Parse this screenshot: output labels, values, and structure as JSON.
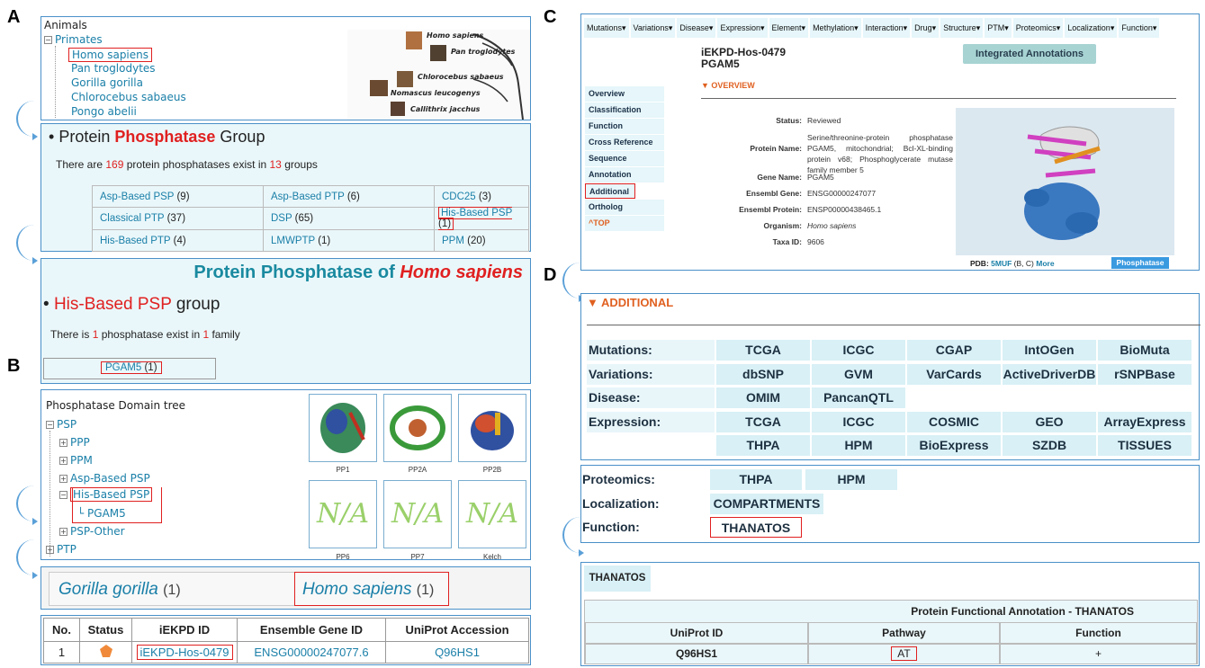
{
  "labels": {
    "a": "A",
    "b": "B",
    "c": "C",
    "d": "D"
  },
  "animals": {
    "title": "Animals",
    "root": "Primates",
    "items": [
      "Homo sapiens",
      "Pan troglodytes",
      "Gorilla gorilla",
      "Chlorocebus sabaeus",
      "Pongo abelii"
    ],
    "tree_species": [
      "Homo sapiens",
      "Pan troglodytes",
      "Chlorocebus sabaeus",
      "Nomascus leucogenys",
      "Callithrix jacchus"
    ]
  },
  "group": {
    "bullet": "•",
    "title_pre": "Protein ",
    "title_red": "Phosphatase",
    "title_post": " Group",
    "sub_pre": "There are ",
    "count": "169",
    "sub_mid": " protein phosphatases exist in ",
    "groups": "13",
    "sub_post": " groups",
    "cells": [
      {
        "name": "Asp-Based PSP",
        "count": "(9)"
      },
      {
        "name": "Asp-Based PTP",
        "count": "(6)"
      },
      {
        "name": "CDC25",
        "count": "(3)"
      },
      {
        "name": "Classical PTP",
        "count": "(37)"
      },
      {
        "name": "DSP",
        "count": "(65)"
      },
      {
        "name": "His-Based PSP",
        "count": "(1)"
      },
      {
        "name": "His-Based PTP",
        "count": "(4)"
      },
      {
        "name": "LMWPTP",
        "count": "(1)"
      },
      {
        "name": "PPM",
        "count": "(20)"
      }
    ]
  },
  "species_page": {
    "title_pre": "Protein Phosphatase of ",
    "title_species": "Homo sapiens",
    "bullet": "•",
    "group_red": "His-Based PSP",
    "group_post": " group",
    "sub_pre": "There is ",
    "n1": "1",
    "sub_mid": " phosphatase exist in ",
    "n2": "1",
    "sub_post": " family",
    "family": "PGAM5",
    "family_count": "(1)"
  },
  "domain_tree": {
    "title": "Phosphatase Domain tree",
    "root": "PSP",
    "items": [
      "PPP",
      "PPM",
      "Asp-Based PSP",
      "His-Based PSP",
      "PGAM5",
      "PSP-Other",
      "PTP"
    ],
    "thumbs": [
      "PP1",
      "PP2A",
      "PP2B",
      "PP6",
      "PP7",
      "Kelch"
    ],
    "na": "N/A"
  },
  "species_tabs": [
    {
      "name": "Gorilla gorilla",
      "count": "(1)"
    },
    {
      "name": "Homo sapiens",
      "count": "(1)"
    }
  ],
  "results_table": {
    "headers": [
      "No.",
      "Status",
      "iEKPD ID",
      "Ensemble Gene ID",
      "UniProt Accession"
    ],
    "row": {
      "no": "1",
      "id": "iEKPD-Hos-0479",
      "gene": "ENSG00000247077.6",
      "uniprot": "Q96HS1"
    },
    "status_color": "#f08a3a"
  },
  "detail": {
    "menu": [
      "Mutations▾",
      "Variations▾",
      "Disease▾",
      "Expression▾",
      "Element▾",
      "Methylation▾",
      "Interaction▾",
      "Drug▾",
      "Structure▾",
      "PTM▾",
      "Proteomics▾",
      "Localization▾",
      "Function▾"
    ],
    "id": "iEKPD-Hos-0479",
    "gene": "PGAM5",
    "integrated": "Integrated Annotations",
    "overview_hdr": "▼ OVERVIEW",
    "side": [
      "Overview",
      "Classification",
      "Function",
      "Cross Reference",
      "Sequence",
      "Annotation",
      "Additional",
      "Ortholog",
      "^TOP"
    ],
    "fields": [
      {
        "label": "Status:",
        "value": "Reviewed"
      },
      {
        "label": "Protein Name:",
        "value": "Serine/threonine-protein phosphatase PGAM5, mitochondrial;  Bcl-XL-binding  protein  v68; Phosphoglycerate mutase family member 5"
      },
      {
        "label": "Gene Name:",
        "value": "PGAM5"
      },
      {
        "label": "Ensembl Gene:",
        "value": "ENSG00000247077"
      },
      {
        "label": "Ensembl Protein:",
        "value": "ENSP00000438465.1"
      },
      {
        "label": "Organism:",
        "value": "Homo sapiens"
      },
      {
        "label": "Taxa ID:",
        "value": "9606"
      }
    ],
    "pdb_label": "PDB:",
    "pdb_id": "5MUF",
    "pdb_chains": "(B, C)",
    "pdb_more": "More",
    "badge": "Phosphatase"
  },
  "additional": {
    "header": "▼ ADDITIONAL",
    "rows": [
      {
        "label": "Mutations:",
        "items": [
          "TCGA",
          "ICGC",
          "CGAP",
          "IntOGen",
          "BioMuta"
        ]
      },
      {
        "label": "Variations:",
        "items": [
          "dbSNP",
          "GVM",
          "VarCards",
          "ActiveDriverDB",
          "rSNPBase"
        ]
      },
      {
        "label": "Disease:",
        "items": [
          "OMIM",
          "PancanQTL"
        ]
      },
      {
        "label": "Expression:",
        "items": [
          "TCGA",
          "ICGC",
          "COSMIC",
          "GEO",
          "ArrayExpress"
        ]
      },
      {
        "label": "",
        "items": [
          "THPA",
          "HPM",
          "BioExpress",
          "SZDB",
          "TISSUES"
        ]
      }
    ]
  },
  "additional2": {
    "rows": [
      {
        "label": "Proteomics:",
        "items": [
          "THPA",
          "HPM"
        ]
      },
      {
        "label": "Localization:",
        "items": [
          "COMPARTMENTS"
        ]
      },
      {
        "label": "Function:",
        "items": [
          "THANATOS"
        ]
      }
    ]
  },
  "thanatos": {
    "tab": "THANATOS",
    "caption": "Protein Functional Annotation - THANATOS",
    "headers": [
      "UniProt ID",
      "Pathway",
      "Function"
    ],
    "row": [
      "Q96HS1",
      "AT",
      "+"
    ]
  }
}
